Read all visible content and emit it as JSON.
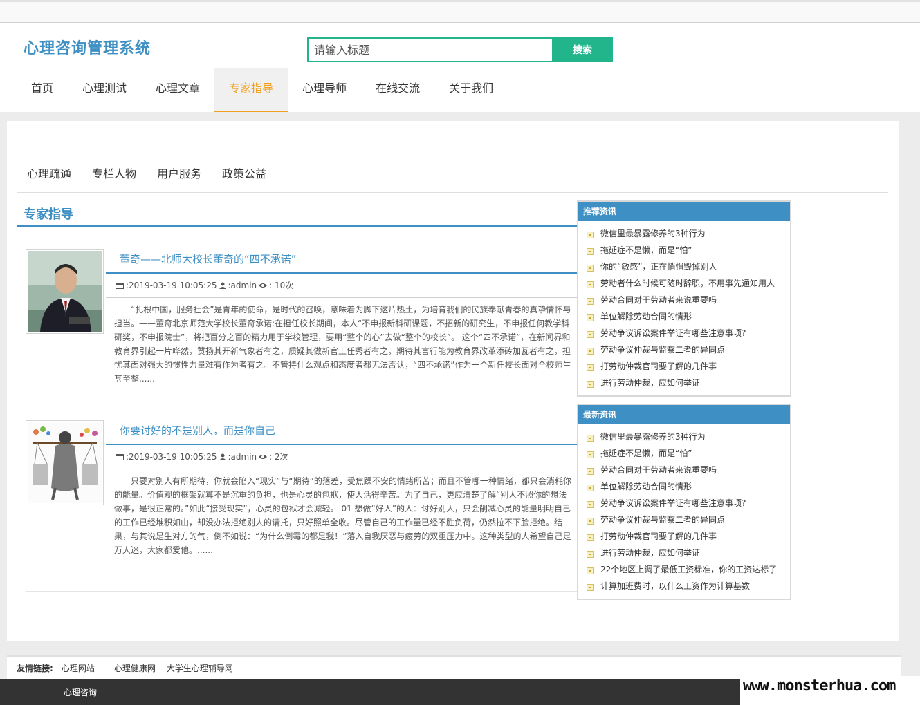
{
  "site": {
    "logo": "心理咨询管理系统",
    "search_placeholder": "请输入标题",
    "search_button": "搜索"
  },
  "nav": {
    "items": [
      "首页",
      "心理测试",
      "心理文章",
      "专家指导",
      "心理导师",
      "在线交流",
      "关于我们"
    ],
    "active": "专家指导"
  },
  "subnav": {
    "items": [
      "心理疏通",
      "专栏人物",
      "用户服务",
      "政策公益"
    ]
  },
  "section": {
    "title": "专家指导"
  },
  "articles": [
    {
      "title": "董奇——北师大校长董奇的“四不承诺”",
      "time": ":2019-03-19 10:05:25",
      "author": ":admin",
      "views": ": 10次",
      "excerpt": "“扎根中国，服务社会”是青年的使命，是时代的召唤，意味着为脚下这片热土，为培育我们的民族奉献青春的真挚情怀与担当。——董奇北京师范大学校长董奇承诺:在担任校长期间，本人“不申报新科研课题，不招新的研究生，不申报任何教学科研奖，不申报院士”，将把百分之百的精力用于学校管理，要用“整个的心”去做“整个的校长”。  这个“四不承诺”，在新闻界和教育界引起一片哗然，赞扬其开新气象者有之，质疑其做新官上任秀者有之，期待其言行能为教育界改革添砖加瓦者有之，担忧其面对强大的惯性力量难有作为者有之。不管持什么观点和态度者都无法否认，“四不承诺”作为一个新任校长面对全校师生甚至整......"
    },
    {
      "title": "你要讨好的不是别人，而是你自己",
      "time": ":2019-03-19 10:05:25",
      "author": ":admin",
      "views": ": 2次",
      "excerpt": "只要对别人有所期待，你就会陷入“现实”与“期待”的落差，受焦躁不安的情绪所苦；而且不管哪一种情绪，都只会消耗你的能量。价值观的框架就算不是沉重的负担，也是心灵的包袱，使人活得辛苦。为了自己，更应清楚了解“别人不照你的想法做事，是很正常的。”如此“接受现实”，心灵的包袱才会减轻。 01 想做“好人”的人：讨好别人，只会削减心灵的能量明明自己的工作已经堆积如山，却没办法拒绝别人的请托，只好照单全收。尽管自己的工作量已经不胜负荷，仍然拉不下脸拒绝。结果，与其说是生对方的气，倒不如说：“为什么倒霉的都是我！”落入自我厌恶与疲劳的双重压力中。这种类型的人希望自己是万人迷，大家都爱他。......"
    }
  ],
  "sidebar": {
    "recommended": {
      "title": "推荐资讯",
      "items": [
        "微信里最暴露修养的3种行为",
        "拖延症不是懒，而是“怕”",
        "你的“敏感”，正在悄悄毁掉别人",
        "劳动者什么时候可随时辞职，不用事先通知用人",
        "劳动合同对于劳动者来说重要吗",
        "单位解除劳动合同的情形",
        "劳动争议诉讼案件举证有哪些注意事项?",
        "劳动争议仲裁与监察二者的异同点",
        "打劳动仲裁官司要了解的几件事",
        "进行劳动仲裁，应如何举证"
      ]
    },
    "latest": {
      "title": "最新资讯",
      "items": [
        "微信里最暴露修养的3种行为",
        "拖延症不是懒，而是“怕”",
        "劳动合同对于劳动者来说重要吗",
        "单位解除劳动合同的情形",
        "劳动争议诉讼案件举证有哪些注意事项?",
        "劳动争议仲裁与监察二者的异同点",
        "打劳动仲裁官司要了解的几件事",
        "进行劳动仲裁，应如何举证",
        "22个地区上调了最低工资标准，你的工资达标了",
        "计算加班费时，以什么工资作为计算基数"
      ]
    }
  },
  "friend_links": {
    "label": "友情链接:",
    "items": [
      "心理网站一",
      "心理健康网",
      "大学生心理辅导网"
    ]
  },
  "footer": {
    "text": "心理咨询"
  },
  "watermark": "www.monsterhua.com",
  "colors": {
    "brand_blue": "#3e8fc4",
    "search_green": "#22b48b",
    "active_orange": "#f0a020"
  }
}
